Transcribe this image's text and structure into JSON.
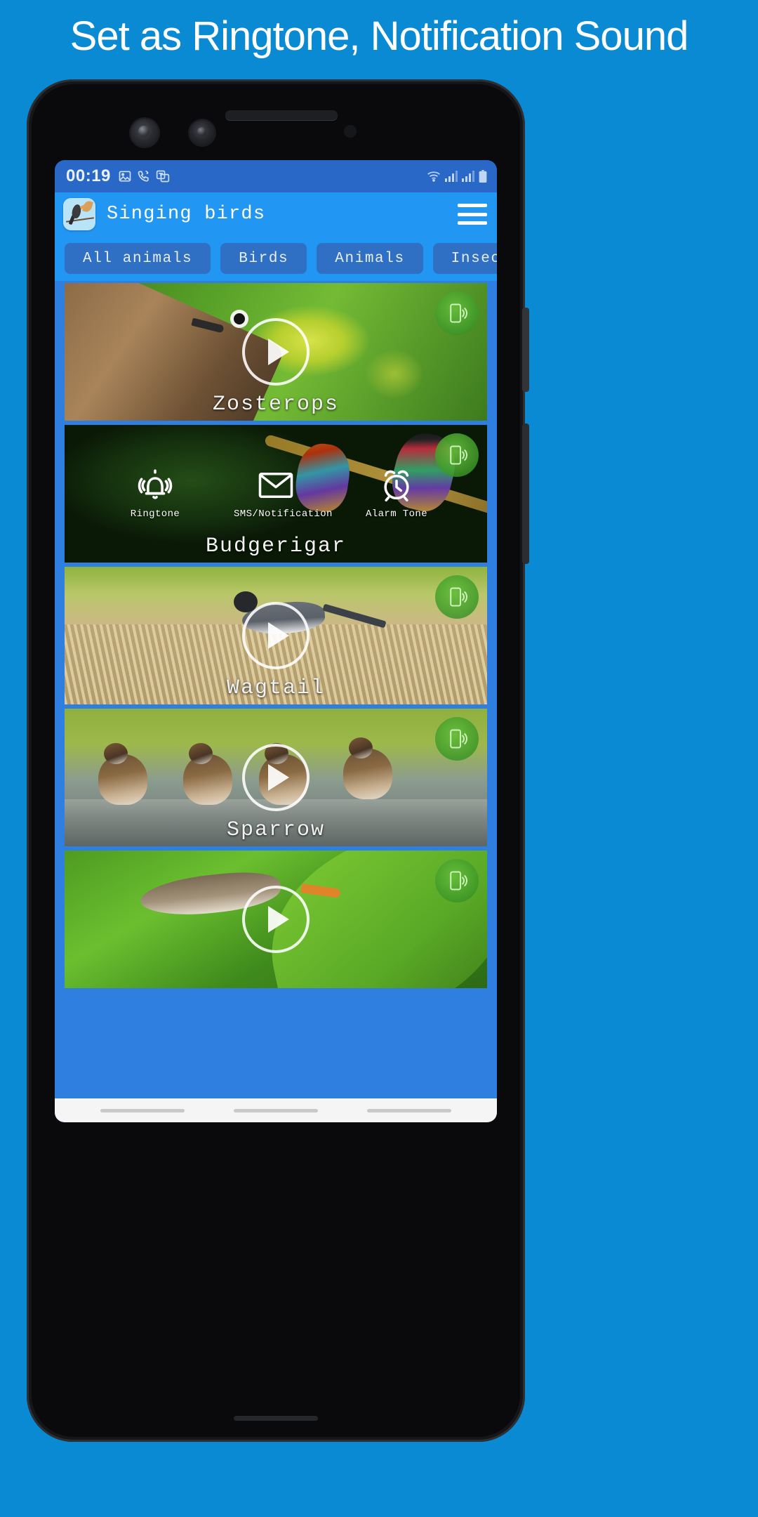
{
  "headline": "Set as Ringtone, Notification Sound",
  "colors": {
    "page_background": "#0b8ad4",
    "status_bar": "#2a68c8",
    "app_bar": "#2196f3",
    "chip": "#2f6fc4",
    "list_background": "#2f7fe0",
    "badge_green": "#4fae2e",
    "headline_text": "#ffffff"
  },
  "status_bar": {
    "time": "00:19",
    "left_icons": [
      "image-icon",
      "missed-call-icon",
      "translate-icon"
    ],
    "right_icons": [
      "wifi-icon",
      "signal-1-icon",
      "signal-2-icon",
      "battery-icon"
    ]
  },
  "app_bar": {
    "app_icon": "bird-app-icon",
    "title": "Singing birds",
    "menu_icon": "hamburger-menu-icon"
  },
  "filters": {
    "chips": [
      {
        "label": "All animals",
        "selected": true
      },
      {
        "label": "Birds",
        "selected": false
      },
      {
        "label": "Animals",
        "selected": false
      },
      {
        "label": "Insect",
        "selected": false
      }
    ]
  },
  "list": {
    "items": [
      {
        "title": "Zosterops",
        "badge_icon": "phone-vibrate-icon",
        "play_icon": "play-icon",
        "state": "collapsed"
      },
      {
        "title": "Budgerigar",
        "badge_icon": "phone-vibrate-icon",
        "state": "expanded",
        "actions": [
          {
            "label": "Ringtone",
            "icon": "bell-ringing-icon"
          },
          {
            "label": "SMS/Notification",
            "icon": "envelope-icon"
          },
          {
            "label": "Alarm Tone",
            "icon": "alarm-clock-icon"
          }
        ]
      },
      {
        "title": "Wagtail",
        "badge_icon": "phone-vibrate-icon",
        "play_icon": "play-icon",
        "state": "collapsed"
      },
      {
        "title": "Sparrow",
        "badge_icon": "phone-vibrate-icon",
        "play_icon": "play-icon",
        "state": "collapsed"
      },
      {
        "title": "",
        "badge_icon": "phone-vibrate-icon",
        "play_icon": "play-icon",
        "state": "collapsed"
      }
    ]
  },
  "nav_bar": {
    "items": [
      "recents-pill",
      "home-pill",
      "back-pill"
    ]
  }
}
